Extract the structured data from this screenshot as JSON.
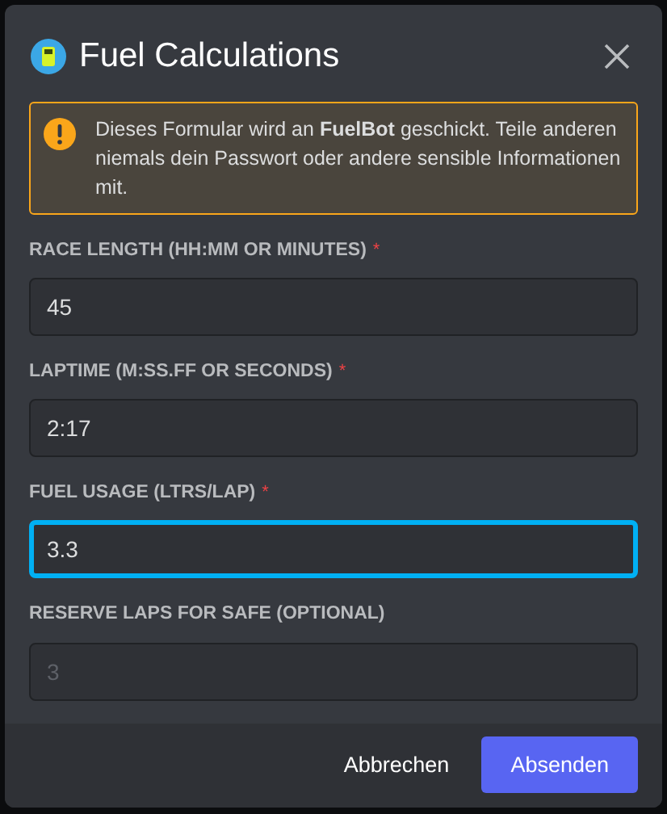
{
  "dialog": {
    "title": "Fuel Calculations",
    "notice": "Dieses Formular wird an **FuelBot** geschickt. Teile anderen niemals dein Passwort oder andere sensible Informationen mit."
  },
  "fields": [
    {
      "label": "RACE LENGTH (HH:MM OR MINUTES)",
      "required": true,
      "value": "45",
      "focused": false
    },
    {
      "label": "LAPTIME (M:SS.FF OR SECONDS)",
      "required": true,
      "value": "2:17",
      "focused": false
    },
    {
      "label": "FUEL USAGE (LTRS/LAP)",
      "required": true,
      "value": "3.3",
      "focused": true
    },
    {
      "label": "RESERVE LAPS FOR SAFE (OPTIONAL)",
      "required": false,
      "placeholder": "3",
      "focused": false
    }
  ],
  "required_mark": "*",
  "buttons": [
    {
      "label": "Abbrechen",
      "kind": "link"
    },
    {
      "label": "Absenden",
      "kind": "primary"
    }
  ]
}
